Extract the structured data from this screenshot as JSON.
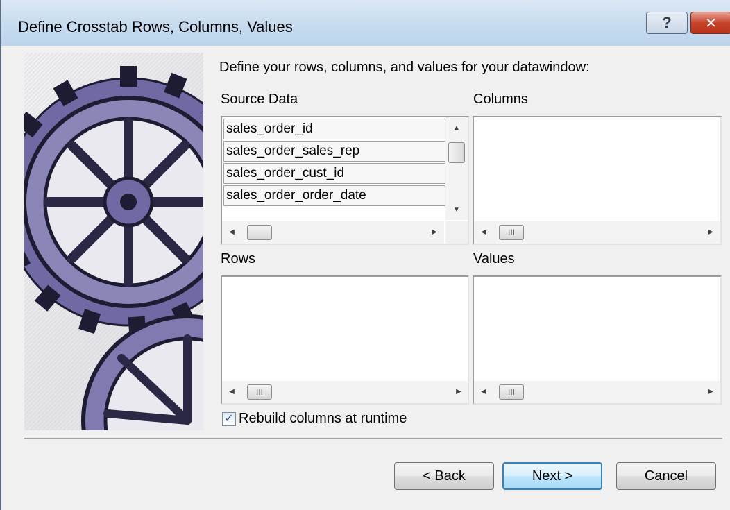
{
  "window": {
    "title": "Define Crosstab Rows, Columns, Values",
    "help_glyph": "?",
    "close_glyph": "✕"
  },
  "instruction": "Define your rows, columns, and values for your datawindow:",
  "source_data": {
    "label": "Source Data",
    "items": [
      "sales_order_id",
      "sales_order_sales_rep",
      "sales_order_cust_id",
      "sales_order_order_date"
    ]
  },
  "columns": {
    "label": "Columns",
    "items": []
  },
  "rows": {
    "label": "Rows",
    "items": []
  },
  "values": {
    "label": "Values",
    "items": []
  },
  "scroll": {
    "thumb_grip": "III",
    "up": "▲",
    "down": "▼",
    "left": "◀",
    "right": "▶"
  },
  "rebuild_checkbox": {
    "label": "Rebuild columns at runtime",
    "checked": true,
    "check_glyph": "✓"
  },
  "buttons": {
    "back": "< Back",
    "next": "Next >",
    "cancel": "Cancel"
  },
  "colors": {
    "title_bar": "#c6dbee",
    "dialog_bg": "#f0f0f0",
    "default_button_border": "#3c7fb1",
    "gear_tint": "#5a5890"
  }
}
